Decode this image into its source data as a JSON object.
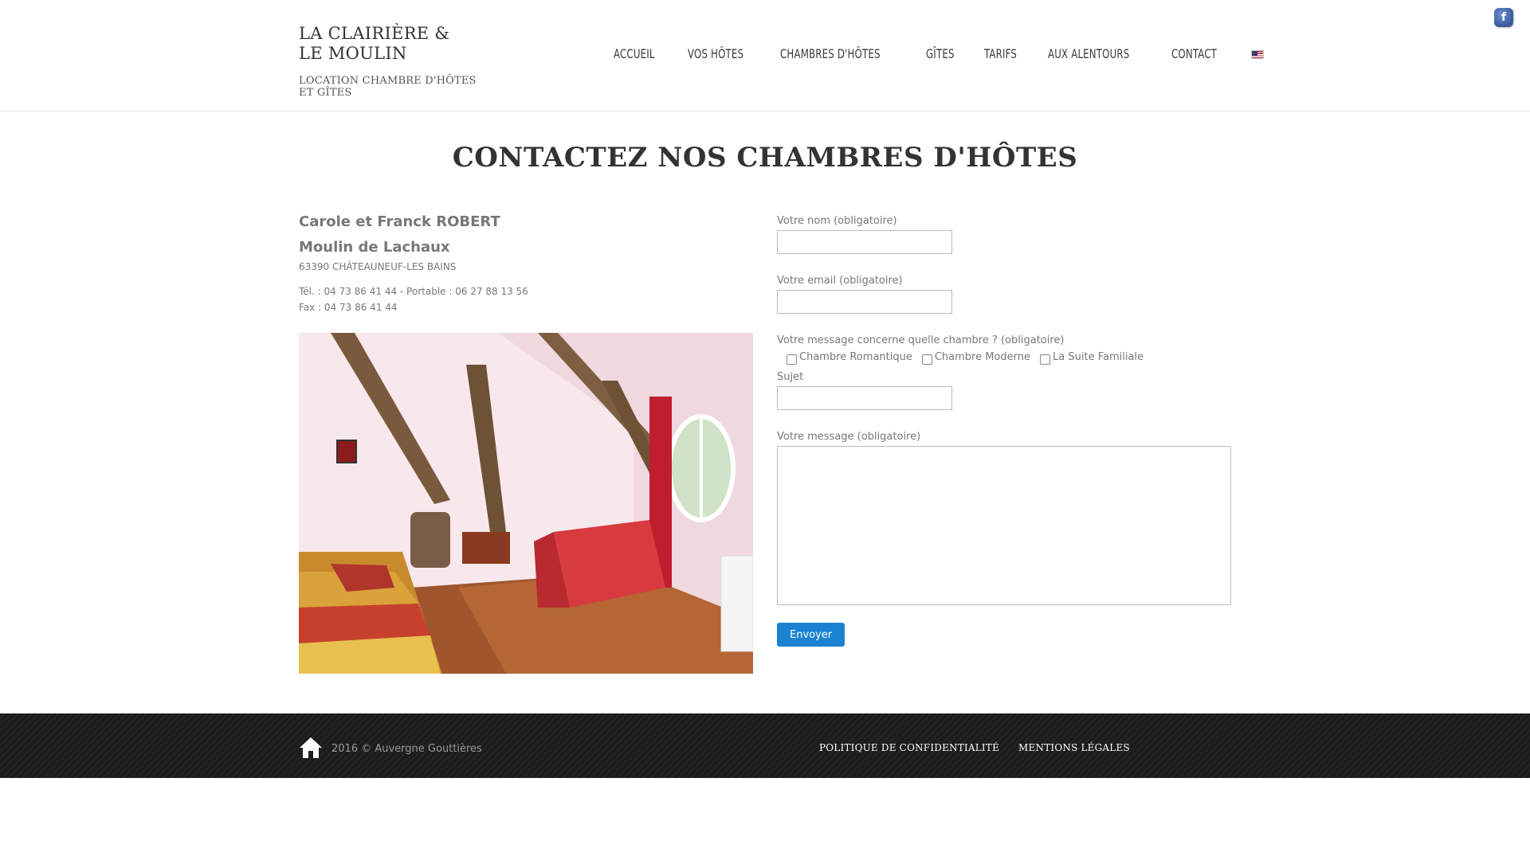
{
  "brand": {
    "title_line1": "LA CLAIRIÈRE &",
    "title_line2": "LE MOULIN",
    "tagline": "LOCATION CHAMBRE D'HÔTES ET GÎTES"
  },
  "nav": {
    "items": [
      "ACCUEIL",
      "VOS HÔTES",
      "CHAMBRES D'HÔTES",
      "GÎTES",
      "TARIFS",
      "AUX ALENTOURS",
      "CONTACT"
    ],
    "language_flag": "english-flag-icon"
  },
  "social": {
    "facebook": "f"
  },
  "page": {
    "title": "CONTACTEZ NOS CHAMBRES D'HÔTES"
  },
  "contact": {
    "name": "Carole et Franck ROBERT",
    "place": "Moulin de Lachaux",
    "address": "63390 CHÂTEAUNEUF-LES BAINS",
    "phone": "Tél. : 04 73 86 41 44 - Portable : 06 27 88 13 56",
    "fax": "Fax : 04 73 86 41 44"
  },
  "form": {
    "name_label": "Votre nom (obligatoire)",
    "name_value": "",
    "email_label": "Votre email (obligatoire)",
    "email_value": "",
    "room_label": "Votre message concerne quelle chambre ? (obligatoire)",
    "rooms": [
      "Chambre Romantique",
      "Chambre Moderne",
      "La Suite Familiale"
    ],
    "subject_label": "Sujet",
    "subject_value": "",
    "message_label": "Votre message (obligatoire)",
    "message_value": "",
    "submit_label": "Envoyer"
  },
  "footer": {
    "copyright": "2016 © Auvergne Gouttières",
    "links": [
      "POLITIQUE DE CONFIDENTIALITÉ",
      "MENTIONS LÉGALES"
    ]
  },
  "colors": {
    "accent": "#1b82d1",
    "footer_bg": "#1e1e1e",
    "facebook": "#3b5998"
  }
}
